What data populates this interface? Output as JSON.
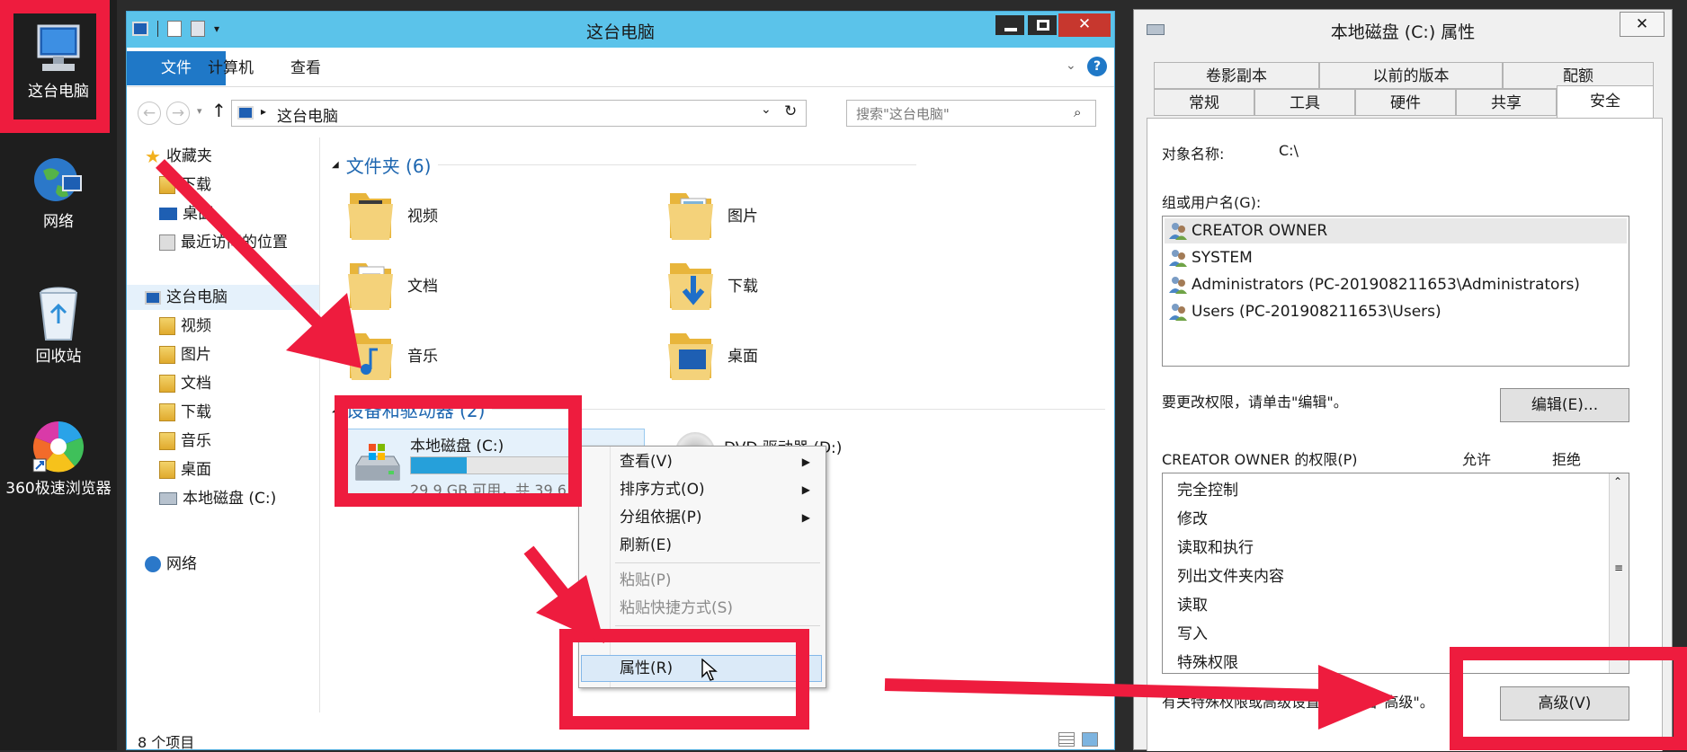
{
  "desktop": {
    "icons": [
      {
        "label": "这台电脑",
        "icon": "computer-icon"
      },
      {
        "label": "网络",
        "icon": "network-globe-icon"
      },
      {
        "label": "回收站",
        "icon": "recycle-bin-icon"
      },
      {
        "label": "360极速浏览器",
        "icon": "360-browser-icon"
      }
    ]
  },
  "explorer": {
    "title": "这台电脑",
    "ribbon_tabs": [
      "文件",
      "计算机",
      "查看"
    ],
    "address": "这台电脑",
    "search_placeholder": "搜索\"这台电脑\"",
    "nav": {
      "favorites": "收藏夹",
      "fav_items": [
        "下载",
        "桌面",
        "最近访问的位置"
      ],
      "this_pc": "这台电脑",
      "pc_items": [
        "视频",
        "图片",
        "文档",
        "下载",
        "音乐",
        "桌面",
        "本地磁盘 (C:)"
      ],
      "network": "网络"
    },
    "folders_header": "文件夹 (6)",
    "folders": [
      "视频",
      "图片",
      "文档",
      "下载",
      "音乐",
      "桌面"
    ],
    "devices_header": "设备和驱动器 (2)",
    "drive": {
      "name": "本地磁盘 (C:)",
      "free_text": "29.9 GB 可用，共 39.6 GB",
      "used_fraction": 0.25
    },
    "dvd_label": "DVD 驱动器 (D:)",
    "status": "8 个项目",
    "context_menu": {
      "items": [
        {
          "label": "查看(V)",
          "submenu": true,
          "disabled": false
        },
        {
          "label": "排序方式(O)",
          "submenu": true,
          "disabled": false
        },
        {
          "label": "分组依据(P)",
          "submenu": true,
          "disabled": false
        },
        {
          "label": "刷新(E)",
          "submenu": false,
          "disabled": false
        },
        {
          "label": "粘贴(P)",
          "submenu": false,
          "disabled": true
        },
        {
          "label": "粘贴快捷方式(S)",
          "submenu": false,
          "disabled": true
        },
        {
          "label": "属性(R)",
          "submenu": false,
          "disabled": false
        }
      ]
    }
  },
  "dialog": {
    "title": "本地磁盘 (C:) 属性",
    "tabs_row1": [
      "卷影副本",
      "以前的版本",
      "配额"
    ],
    "tabs_row2": [
      "常规",
      "工具",
      "硬件",
      "共享",
      "安全"
    ],
    "object_label": "对象名称:",
    "object_value": "C:\\",
    "groups_label": "组或用户名(G):",
    "users": [
      "CREATOR OWNER",
      "SYSTEM",
      "Administrators (PC-201908211653\\Administrators)",
      "Users (PC-201908211653\\Users)"
    ],
    "change_hint": "要更改权限，请单击\"编辑\"。",
    "edit_button": "编辑(E)...",
    "perm_header": "CREATOR OWNER 的权限(P)",
    "allow_label": "允许",
    "deny_label": "拒绝",
    "permissions": [
      "完全控制",
      "修改",
      "读取和执行",
      "列出文件夹内容",
      "读取",
      "写入",
      "特殊权限"
    ],
    "advanced_hint": "有关特殊权限或高级设置，请单击\"高级\"。",
    "advanced_button": "高级(V)"
  },
  "colors": {
    "annotation_red": "#ee1c3e",
    "title_blue": "#5bc3ea",
    "ribbon_file_blue": "#1f78c7"
  }
}
